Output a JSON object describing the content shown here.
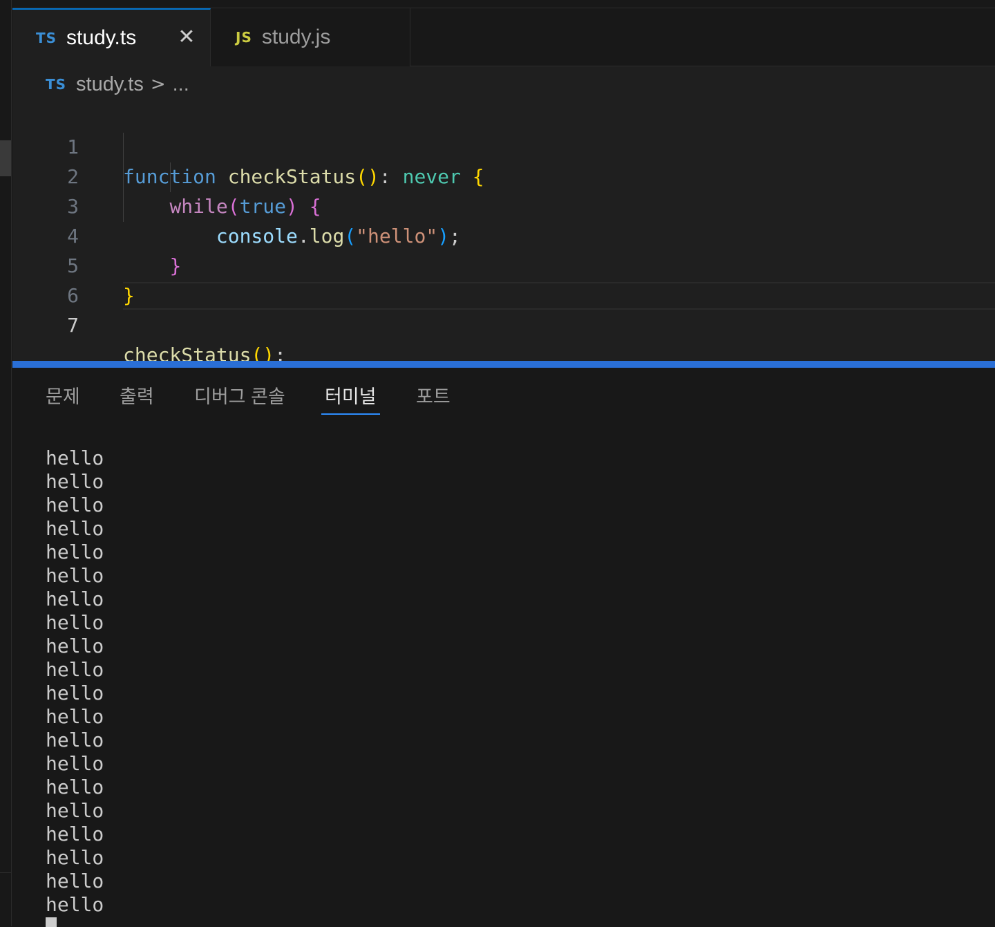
{
  "tabs": [
    {
      "lang": "TS",
      "label": "study.ts",
      "active": true,
      "close_icon": "close-icon"
    },
    {
      "lang": "JS",
      "label": "study.js",
      "active": false
    }
  ],
  "breadcrumb": {
    "lang": "TS",
    "file": "study.ts",
    "separator": ">",
    "more": "..."
  },
  "code": {
    "line_numbers": [
      "1",
      "2",
      "3",
      "4",
      "5",
      "6",
      "7"
    ],
    "current_line": 7
  },
  "panel": {
    "tabs": [
      "문제",
      "출력",
      "디버그 콘솔",
      "터미널",
      "포트"
    ],
    "active_tab": "터미널"
  },
  "terminal": {
    "lines": [
      "hello",
      "hello",
      "hello",
      "hello",
      "hello",
      "hello",
      "hello",
      "hello",
      "hello",
      "hello",
      "hello",
      "hello",
      "hello",
      "hello",
      "hello",
      "hello",
      "hello",
      "hello",
      "hello",
      "hello"
    ]
  },
  "colors": {
    "accent": "#0078d4",
    "sash": "#2a6fd6",
    "editor_bg": "#1f1f1f",
    "panel_bg": "#181818"
  }
}
